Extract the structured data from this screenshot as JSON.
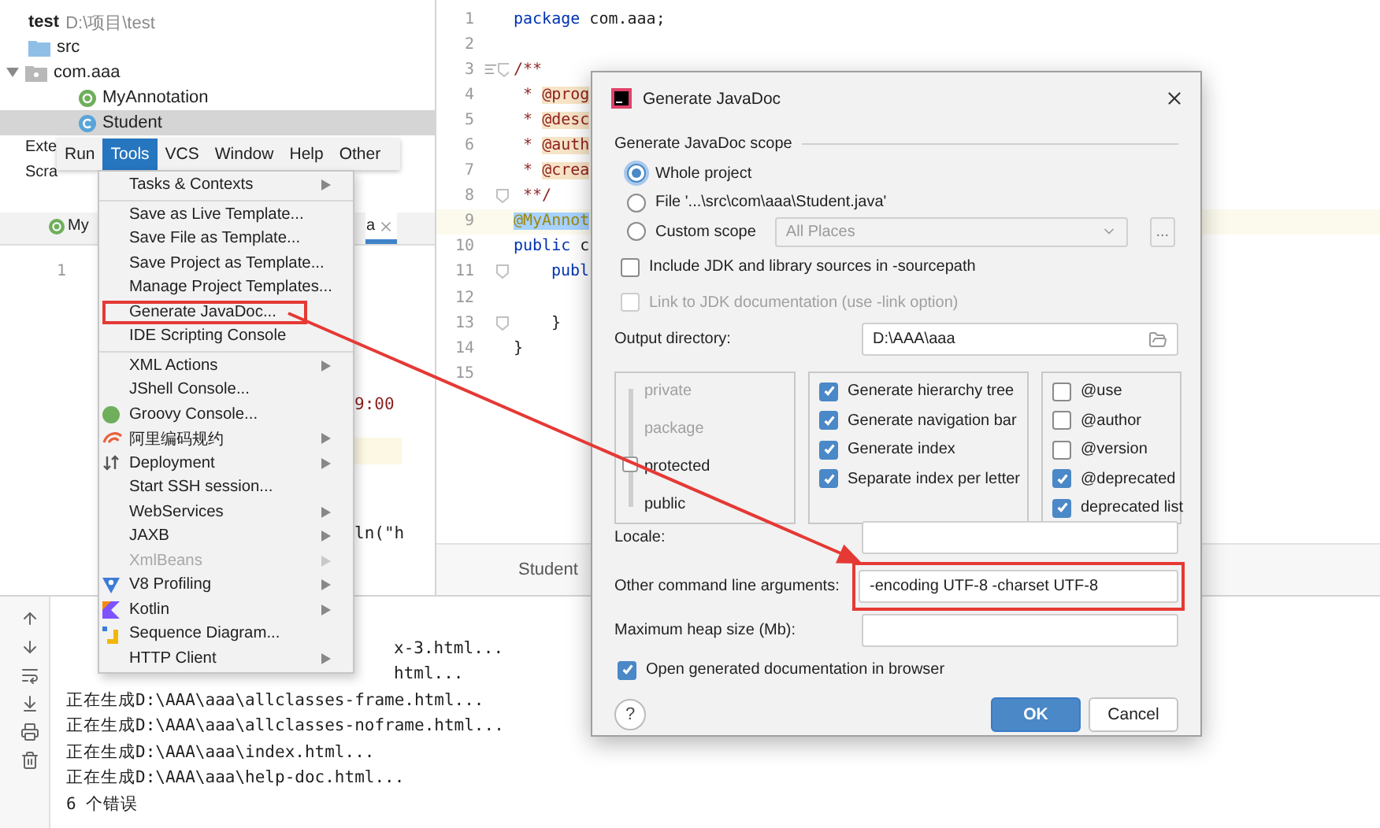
{
  "project": {
    "name": "test",
    "path": "D:\\项目\\test",
    "tree": [
      {
        "label": "src",
        "kind": "folder",
        "selected": false
      },
      {
        "label": "com.aaa",
        "kind": "package",
        "selected": false,
        "expanded": true,
        "children": [
          {
            "label": "MyAnnotation",
            "kind": "annotation",
            "selected": false
          },
          {
            "label": "Student",
            "kind": "class",
            "selected": true
          }
        ]
      }
    ]
  },
  "side_labels": [
    "Exte",
    "Scra"
  ],
  "left_editor": {
    "tabs": [
      {
        "label": "My",
        "kind": "annotation",
        "selected": false
      },
      {
        "label": "a",
        "kind": "plain",
        "selected": true
      }
    ],
    "line_number": "1",
    "fragments": [
      {
        "text": "9:00",
        "kind": "doc"
      },
      {
        "text": "ln(\"h",
        "kind": "plain"
      }
    ],
    "highlighted_line": true
  },
  "editor": {
    "lines": [
      {
        "number": "1",
        "segments": [
          {
            "text": "package",
            "kind": "keyword"
          },
          {
            "text": " com.aaa;",
            "kind": "plain"
          }
        ]
      },
      {
        "number": "2"
      },
      {
        "number": "3",
        "fold": true,
        "doc_icon": true,
        "segments": [
          {
            "text": "/**",
            "kind": "doc"
          }
        ]
      },
      {
        "number": "4",
        "segments": [
          {
            "text": " * ",
            "kind": "doc"
          },
          {
            "text": "@prog",
            "kind": "tag"
          }
        ]
      },
      {
        "number": "5",
        "segments": [
          {
            "text": " * ",
            "kind": "doc"
          },
          {
            "text": "@desc",
            "kind": "tag"
          }
        ]
      },
      {
        "number": "6",
        "segments": [
          {
            "text": " * ",
            "kind": "doc"
          },
          {
            "text": "@auth",
            "kind": "tag"
          }
        ]
      },
      {
        "number": "7",
        "segments": [
          {
            "text": " * ",
            "kind": "doc"
          },
          {
            "text": "@crea",
            "kind": "tag"
          }
        ]
      },
      {
        "number": "8",
        "fold": true,
        "segments": [
          {
            "text": " **/",
            "kind": "doc"
          }
        ]
      },
      {
        "number": "9",
        "current": true,
        "segments": [
          {
            "text": "@MyAnnot",
            "kind": "annotation"
          }
        ]
      },
      {
        "number": "10",
        "segments": [
          {
            "text": "public",
            "kind": "keyword"
          },
          {
            "text": " c",
            "kind": "plain"
          }
        ]
      },
      {
        "number": "11",
        "fold": true,
        "segments": [
          {
            "text": "publ",
            "kind": "keyword"
          }
        ]
      },
      {
        "number": "12"
      },
      {
        "number": "13",
        "fold": true,
        "segments": [
          {
            "text": "}",
            "kind": "plain"
          }
        ]
      },
      {
        "number": "14",
        "segments": [
          {
            "text": "}",
            "kind": "plain"
          }
        ]
      },
      {
        "number": "15"
      }
    ],
    "breadcrumb": "Student"
  },
  "console": {
    "lines": [
      {
        "text": "x-3.html..."
      },
      {
        "text": "html..."
      },
      {
        "text": "正在生成D:\\AAA\\aaa\\allclasses-frame.html..."
      },
      {
        "text": "正在生成D:\\AAA\\aaa\\allclasses-noframe.html..."
      },
      {
        "text": "正在生成D:\\AAA\\aaa\\index.html..."
      },
      {
        "text": "正在生成D:\\AAA\\aaa\\help-doc.html..."
      },
      {
        "text": "6 个错误"
      }
    ]
  },
  "menu_bar": [
    {
      "label": "Run",
      "selected": false
    },
    {
      "label": "Tools",
      "selected": true
    },
    {
      "label": "VCS",
      "selected": false
    },
    {
      "label": "Window",
      "selected": false
    },
    {
      "label": "Help",
      "selected": false
    },
    {
      "label": "Other",
      "selected": false
    }
  ],
  "tools_menu": [
    [
      {
        "label": "Tasks & Contexts",
        "kind": "plain",
        "submenu": true,
        "disabled": false,
        "highlighted": false
      }
    ],
    [
      {
        "label": "Save as Live Template...",
        "kind": "plain",
        "submenu": false,
        "disabled": false,
        "highlighted": false
      },
      {
        "label": "Save File as Template...",
        "kind": "plain",
        "submenu": false,
        "disabled": false,
        "highlighted": false
      },
      {
        "label": "Save Project as Template...",
        "kind": "plain",
        "submenu": false,
        "disabled": false,
        "highlighted": false
      },
      {
        "label": "Manage Project Templates...",
        "kind": "plain",
        "submenu": false,
        "disabled": false,
        "highlighted": false
      },
      {
        "label": "Generate JavaDoc...",
        "kind": "plain",
        "submenu": false,
        "disabled": false,
        "highlighted": true
      },
      {
        "label": "IDE Scripting Console",
        "kind": "plain",
        "submenu": false,
        "disabled": false,
        "highlighted": false
      }
    ],
    [
      {
        "label": "XML Actions",
        "kind": "plain",
        "submenu": true,
        "disabled": false,
        "highlighted": false
      },
      {
        "label": "JShell Console...",
        "kind": "plain",
        "submenu": false,
        "disabled": false,
        "highlighted": false
      },
      {
        "label": "Groovy Console...",
        "kind": "groovy",
        "submenu": false,
        "disabled": false,
        "highlighted": false
      },
      {
        "label": "阿里编码规约",
        "kind": "alibaba",
        "submenu": true,
        "disabled": false,
        "highlighted": false
      },
      {
        "label": "Deployment",
        "kind": "deploy",
        "submenu": true,
        "disabled": false,
        "highlighted": false
      },
      {
        "label": "Start SSH session...",
        "kind": "plain",
        "submenu": false,
        "disabled": false,
        "highlighted": false
      },
      {
        "label": "WebServices",
        "kind": "plain",
        "submenu": true,
        "disabled": false,
        "highlighted": false
      },
      {
        "label": "JAXB",
        "kind": "plain",
        "submenu": true,
        "disabled": false,
        "highlighted": false
      },
      {
        "label": "XmlBeans",
        "kind": "plain",
        "submenu": true,
        "disabled": true,
        "highlighted": false
      },
      {
        "label": "V8 Profiling",
        "kind": "v8",
        "submenu": true,
        "disabled": false,
        "highlighted": false
      },
      {
        "label": "Kotlin",
        "kind": "kotlin",
        "submenu": true,
        "disabled": false,
        "highlighted": false
      },
      {
        "label": "Sequence Diagram...",
        "kind": "sequence",
        "submenu": false,
        "disabled": false,
        "highlighted": false
      },
      {
        "label": "HTTP Client",
        "kind": "plain",
        "submenu": true,
        "disabled": false,
        "highlighted": false
      }
    ]
  ],
  "dialog": {
    "title": "Generate JavaDoc",
    "scope": {
      "legend": "Generate JavaDoc scope",
      "options": [
        {
          "label": "Whole project",
          "selected": true
        },
        {
          "label": "File '...\\src\\com\\aaa\\Student.java'",
          "selected": false
        },
        {
          "label": "Custom scope",
          "selected": false
        }
      ],
      "custom_scope": {
        "value": "All Places",
        "disabled": true,
        "browse": "..."
      }
    },
    "include_sources": {
      "label": "Include JDK and library sources in -sourcepath",
      "checked": false,
      "disabled": false
    },
    "link_jdk": {
      "label": "Link to JDK documentation (use -link option)",
      "checked": false,
      "disabled": true
    },
    "output_directory": {
      "label": "Output directory:",
      "value": "D:\\AAA\\aaa"
    },
    "visibility": [
      {
        "label": "private",
        "selected": false
      },
      {
        "label": "package",
        "selected": false
      },
      {
        "label": "protected",
        "selected": true
      },
      {
        "label": "public",
        "selected": false
      }
    ],
    "generate_options": [
      {
        "label": "Generate hierarchy tree",
        "checked": true
      },
      {
        "label": "Generate navigation bar",
        "checked": true
      },
      {
        "label": "Generate index",
        "checked": true
      },
      {
        "label": "Separate index per letter",
        "checked": true
      }
    ],
    "tags": [
      {
        "label": "@use",
        "checked": false
      },
      {
        "label": "@author",
        "checked": false
      },
      {
        "label": "@version",
        "checked": false
      },
      {
        "label": "@deprecated",
        "checked": true
      },
      {
        "label": "deprecated list",
        "checked": true
      }
    ],
    "locale": {
      "label": "Locale:"
    },
    "other_arguments": {
      "label": "Other command line arguments:",
      "value": "-encoding UTF-8 -charset UTF-8",
      "highlighted": true
    },
    "heap_size": {
      "label": "Maximum heap size (Mb):"
    },
    "open_in_browser": {
      "label": "Open generated documentation in browser",
      "checked": true
    },
    "help": "?",
    "buttons": [
      {
        "label": "OK",
        "kind": "primary"
      },
      {
        "label": "Cancel",
        "kind": "secondary"
      }
    ]
  }
}
